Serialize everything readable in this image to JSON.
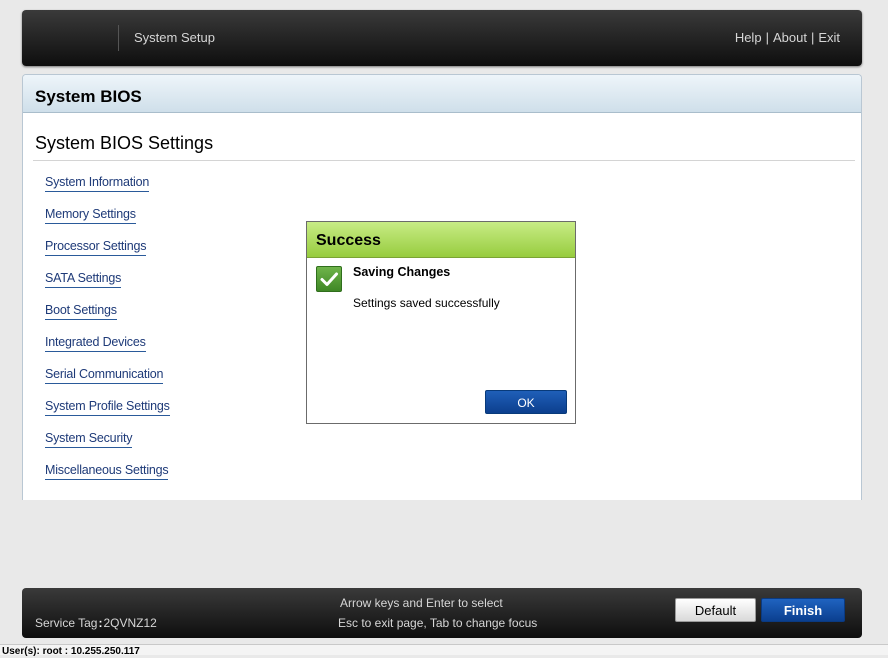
{
  "header": {
    "title": "System Setup",
    "links": {
      "help": "Help",
      "about": "About",
      "exit": "Exit",
      "separator": "|"
    }
  },
  "panel": {
    "title": "System BIOS",
    "subtitle": "System BIOS Settings",
    "menu": [
      "System Information",
      "Memory Settings",
      "Processor Settings",
      "SATA Settings",
      "Boot Settings",
      "Integrated Devices",
      "Serial Communication",
      "System Profile Settings",
      "System Security",
      "Miscellaneous Settings"
    ]
  },
  "dialog": {
    "title": "Success",
    "heading": "Saving Changes",
    "message": "Settings saved successfully",
    "ok_label": "OK",
    "icon": "checkmark-icon"
  },
  "footer": {
    "service_tag_label": "Service Tag",
    "service_tag_sep": ":",
    "service_tag_value": "2QVNZ12",
    "hint_line1": "Arrow keys and Enter to select",
    "hint_line2": "Esc to exit page, Tab to change focus",
    "default_label": "Default",
    "finish_label": "Finish"
  },
  "status_bar": {
    "text": "User(s): root : 10.255.250.117"
  },
  "colors": {
    "header_bg": "#1a1a1a",
    "panel_title_bg": "#cfdfea",
    "link": "#1e3a78",
    "dialog_title_bg": "#97cc3e",
    "primary_button": "#0c3f8e"
  }
}
